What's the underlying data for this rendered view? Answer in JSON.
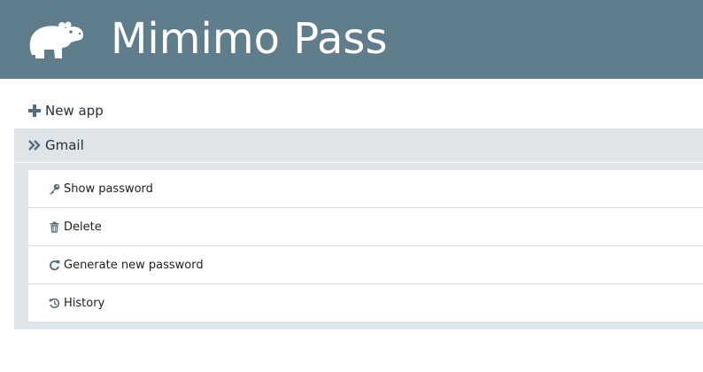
{
  "header": {
    "title": "Mimimo Pass",
    "logo_icon": "hippo-logo-icon",
    "background": "#607d8b"
  },
  "new_app": {
    "label": "New app",
    "icon": "plus-icon"
  },
  "app_group": {
    "name": "Gmail",
    "icon": "double-chevron-right-icon",
    "actions": [
      {
        "label": "Show password",
        "icon": "key-icon"
      },
      {
        "label": "Delete",
        "icon": "trash-icon"
      },
      {
        "label": "Generate new password",
        "icon": "refresh-icon"
      },
      {
        "label": "History",
        "icon": "history-icon"
      }
    ]
  },
  "colors": {
    "accent": "#607d8b",
    "group_bg": "#dfe4e8",
    "icon": "#546e7a"
  }
}
